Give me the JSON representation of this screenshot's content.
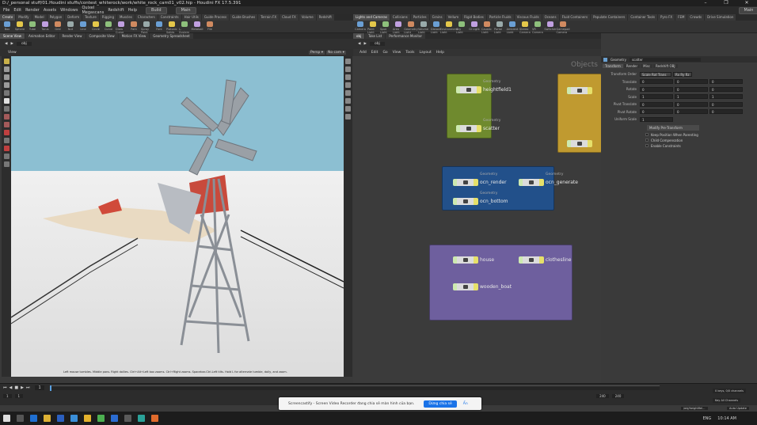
{
  "titlebar": {
    "title": "D:/_personal stuff/01.Houdini stuffs/contest_whiterock/work/white_rock_cam01_v02.hip - Houdini FX 17.5.391"
  },
  "menu": {
    "items": [
      "File",
      "Edit",
      "Render",
      "Assets",
      "Windows",
      "Quixel Megascans",
      "Redshift",
      "Help"
    ],
    "build": "Build",
    "main": "Main"
  },
  "shelf_left": {
    "tabs": [
      "Create",
      "Modify",
      "Model",
      "Polygon",
      "Deform",
      "Texture",
      "Rigging",
      "Muscles",
      "Characters",
      "Constraints",
      "Hair Utils",
      "Guide Process",
      "Guide Brushes",
      "Terrain FX",
      "Cloud FX",
      "Volume",
      "Redshift"
    ],
    "tools": [
      "Box",
      "Sphere",
      "Tube",
      "Torus",
      "Grid",
      "Null",
      "Line",
      "Circle",
      "Curve",
      "Draw Curve",
      "Path",
      "Spray Paint",
      "Font",
      "Platonic Solids",
      "L-System",
      "Metaball",
      "File"
    ]
  },
  "shelf_right": {
    "tabs": [
      "Lights and Cameras",
      "Collisions",
      "Particles",
      "Grains",
      "Vellum",
      "Rigid Bodies",
      "Particle Fluids",
      "Viscous Fluids",
      "Oceans",
      "Fluid Containers",
      "Populate Containers",
      "Container Tools",
      "Pyro FX",
      "FEM",
      "Crowds",
      "Drive Simulation"
    ],
    "tools": [
      "Camera",
      "Point Light",
      "Spot Light",
      "Area Light",
      "Geometry Light",
      "Volume Light",
      "Distant Light",
      "Environment Light",
      "Sky Light",
      "GI Light",
      "Caustic Light",
      "Portal Light",
      "Ambient Light",
      "Stereo Camera",
      "VR Camera",
      "Switcher",
      "Gamepad Camera"
    ]
  },
  "left_panes": {
    "tabs": [
      "Scene View",
      "Animation Editor",
      "Render View",
      "Composite View",
      "Motion FX View",
      "Geometry Spreadsheet"
    ],
    "path": "obj",
    "view_label": "View",
    "persp": "Persp ▾",
    "nocam": "No cam ▾",
    "hint": "Left mouse tumbles. Middle pans. Right dollies. Ctrl+Alt+Left box zooms. Ctrl+Right zooms. Spacebar-Ctrl-Left tilts. Hold L for alternate tumble, dolly, and zoom."
  },
  "right_panes": {
    "tabs": [
      "obj",
      "Take List",
      "Performance Monitor"
    ],
    "path": "obj",
    "menu": [
      "Add",
      "Edit",
      "Go",
      "View",
      "Tools",
      "Layout",
      "Help"
    ],
    "context_label": "Objects"
  },
  "network": {
    "nodes": [
      {
        "name": "heightfield1",
        "cap": "Geometry"
      },
      {
        "name": "scatter",
        "cap": "Geometry"
      },
      {
        "name": "ocn_render",
        "cap": "Geometry"
      },
      {
        "name": "ocn_generate",
        "cap": "Geometry"
      },
      {
        "name": "ocn_bottom",
        "cap": "Geometry"
      },
      {
        "name": "house",
        "cap": ""
      },
      {
        "name": "clothesline",
        "cap": ""
      },
      {
        "name": "wooden_boat",
        "cap": ""
      }
    ]
  },
  "params": {
    "type": "Geometry",
    "name": "scatter",
    "tabs": [
      "Transform",
      "Render",
      "Misc",
      "Redshift OBJ"
    ],
    "rows": [
      {
        "label": "Transform Order",
        "value": "Scale Rot Trans",
        "value2": "Rx Ry Rz"
      },
      {
        "label": "Translate",
        "values": [
          "0",
          "0",
          "0"
        ]
      },
      {
        "label": "Rotate",
        "values": [
          "0",
          "0",
          "0"
        ]
      },
      {
        "label": "Scale",
        "values": [
          "1",
          "1",
          "1"
        ]
      },
      {
        "label": "Pivot Translate",
        "values": [
          "0",
          "0",
          "0"
        ]
      },
      {
        "label": "Pivot Rotate",
        "values": [
          "0",
          "0",
          "0"
        ]
      },
      {
        "label": "Uniform Scale",
        "values": [
          "1"
        ]
      }
    ],
    "modify_button": "Modify Pre-Transform",
    "checks": [
      "Keep Position When Parenting",
      "Child Compensation",
      "Enable Constraints"
    ]
  },
  "timeline": {
    "frame": "1",
    "start": "1",
    "end": "1",
    "end2": "240",
    "end3": "240",
    "keys": "0 keys, 0/0 channels",
    "key_all": "Key All Channels",
    "auto_update": "Auto Update",
    "obj_path": "/obj/heightfiel..."
  },
  "toast": {
    "text": "Screencastify - Screen Video Recorder đang chia sẻ màn hình của bạn.",
    "stop": "Dừng chia sẻ",
    "hide": "Ẩn"
  },
  "taskbar": {
    "lang": "ENG",
    "time": "10:14 AM"
  }
}
